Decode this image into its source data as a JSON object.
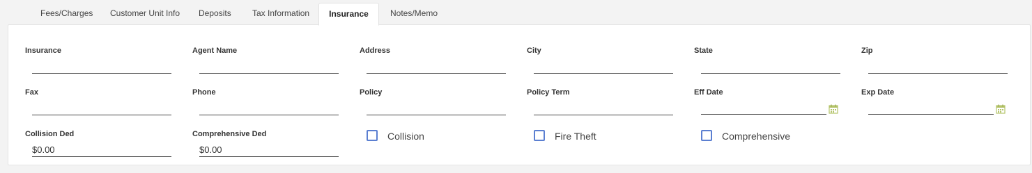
{
  "tabs": [
    {
      "label": "Fees/Charges"
    },
    {
      "label": "Customer Unit Info"
    },
    {
      "label": "Deposits"
    },
    {
      "label": "Tax Information"
    },
    {
      "label": "Insurance"
    },
    {
      "label": "Notes/Memo"
    }
  ],
  "active_tab": "Insurance",
  "fields": {
    "insurance": {
      "label": "Insurance",
      "value": ""
    },
    "agent_name": {
      "label": "Agent Name",
      "value": ""
    },
    "address": {
      "label": "Address",
      "value": ""
    },
    "city": {
      "label": "City",
      "value": ""
    },
    "state": {
      "label": "State",
      "value": ""
    },
    "zip": {
      "label": "Zip",
      "value": ""
    },
    "fax": {
      "label": "Fax",
      "value": ""
    },
    "phone": {
      "label": "Phone",
      "value": ""
    },
    "policy": {
      "label": "Policy",
      "value": ""
    },
    "policy_term": {
      "label": "Policy Term",
      "value": ""
    },
    "eff_date": {
      "label": "Eff Date",
      "value": ""
    },
    "exp_date": {
      "label": "Exp Date",
      "value": ""
    },
    "collision_ded": {
      "label": "Collision Ded",
      "value": "$0.00"
    },
    "comprehensive_ded": {
      "label": "Comprehensive Ded",
      "value": "$0.00"
    }
  },
  "checkboxes": {
    "collision": {
      "label": "Collision",
      "checked": false
    },
    "fire_theft": {
      "label": "Fire Theft",
      "checked": false
    },
    "comprehensive": {
      "label": "Comprehensive",
      "checked": false
    }
  },
  "colors": {
    "checkbox_border": "#5b7fd1",
    "calendar_icon": "#b5c46a"
  }
}
